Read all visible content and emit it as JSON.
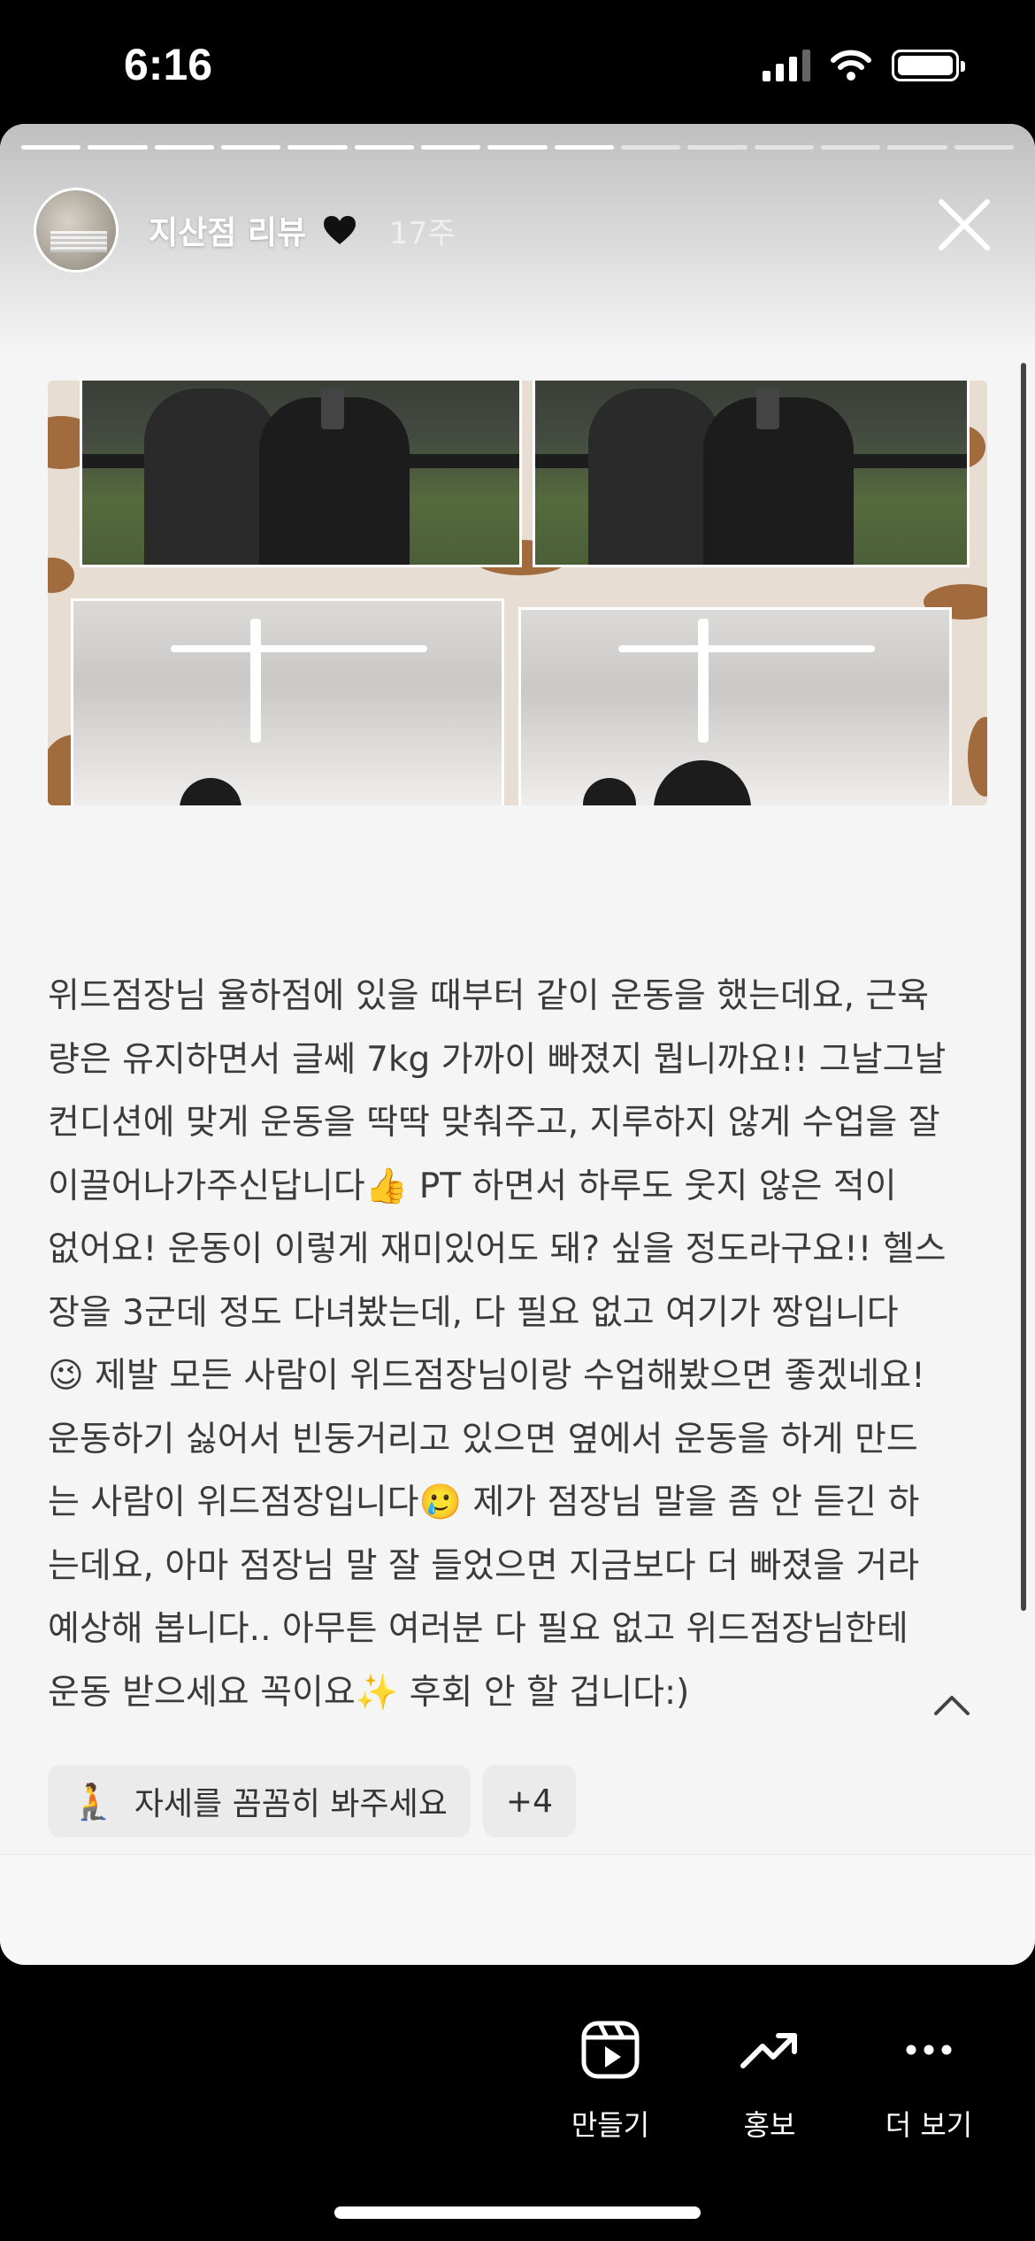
{
  "status_bar": {
    "time": "6:16"
  },
  "story": {
    "title": "지산점 리뷰",
    "age": "17주",
    "progress_total": 15,
    "progress_done": 9
  },
  "review": {
    "text": "위드점장님 율하점에 있을 때부터 같이 운동을 했는데요, 근육\n량은 유지하면서 글쎄 7kg 가까이 빠졌지 뭡니까요!! 그날그날\n컨디션에 맞게 운동을 딱딱 맞춰주고, 지루하지 않게 수업을 잘\n이끌어나가주신답니다👍 PT 하면서 하루도 웃지 않은 적이\n없어요! 운동이 이렇게 재미있어도 돼? 싶을 정도라구요!! 헬스\n장을 3군데 정도 다녀봤는데, 다 필요 없고 여기가 짱입니다\n😉 제발 모든 사람이 위드점장님이랑 수업해봤으면 좋겠네요!\n운동하기 싫어서 빈둥거리고 있으면 옆에서 운동을 하게 만드\n는 사람이 위드점장입니다🥲 제가 점장님 말을 좀 안 듣긴 하\n는데요, 아마 점장님 말 잘 들었으면 지금보다 더 빠졌을 거라\n예상해 봅니다.. 아무튼 여러분 다 필요 없고 위드점장님한테\n운동 받으세요 꼭이요✨ 후회 안 할 겁니다:)"
  },
  "tags": {
    "first": {
      "emoji": "🧎",
      "label": "자세를 꼼꼼히 봐주세요"
    },
    "more": "+4"
  },
  "actions": {
    "create": "만들기",
    "promote": "홍보",
    "more": "더 보기"
  }
}
